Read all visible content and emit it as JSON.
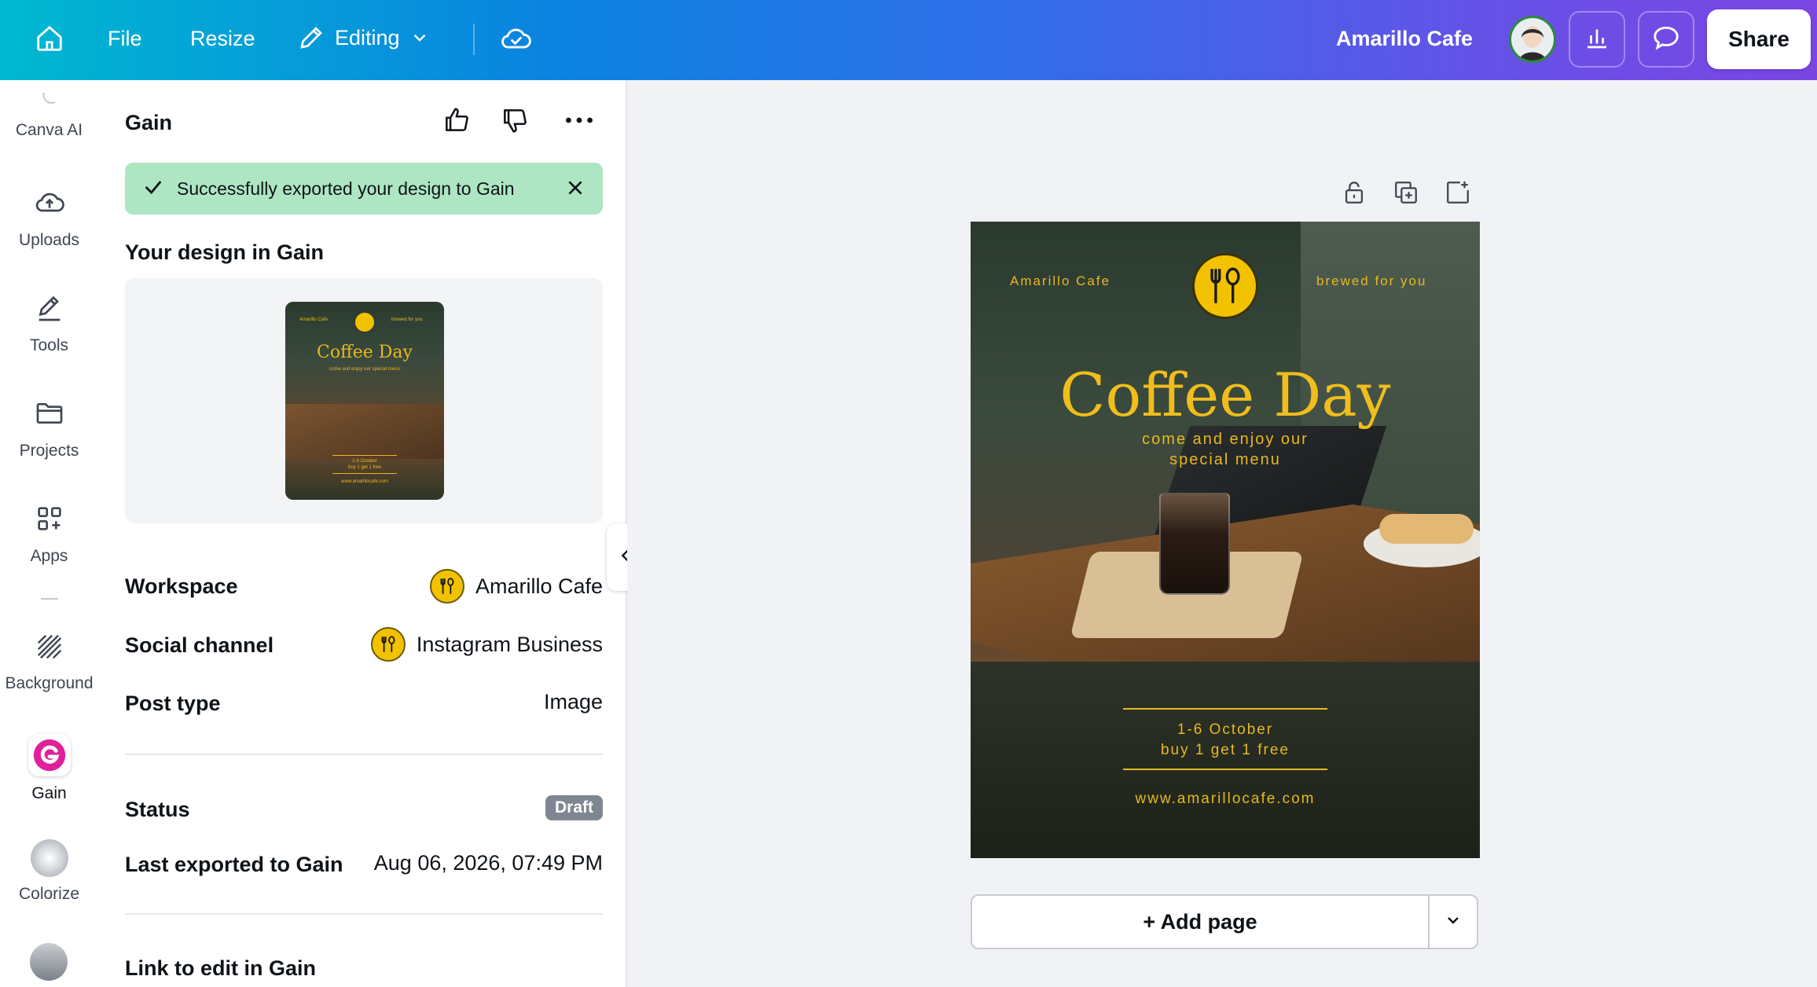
{
  "topbar": {
    "file_label": "File",
    "resize_label": "Resize",
    "editing_label": "Editing",
    "design_name": "Amarillo Cafe",
    "share_label": "Share"
  },
  "rail": {
    "items": [
      {
        "label": "Canva AI",
        "icon": "canva-ai-icon"
      },
      {
        "label": "Uploads",
        "icon": "upload-cloud-icon"
      },
      {
        "label": "Tools",
        "icon": "tools-icon"
      },
      {
        "label": "Projects",
        "icon": "folder-icon"
      },
      {
        "label": "Apps",
        "icon": "apps-icon"
      },
      {
        "label": "Background",
        "icon": "background-icon"
      },
      {
        "label": "Gain",
        "icon": "gain-icon"
      },
      {
        "label": "Colorize",
        "icon": "colorize-icon"
      }
    ]
  },
  "panel": {
    "title": "Gain",
    "toast": "Successfully exported your design to Gain",
    "design_heading": "Your design in Gain",
    "workspace_label": "Workspace",
    "workspace_value": "Amarillo Cafe",
    "social_label": "Social channel",
    "social_value": "Instagram Business",
    "post_type_label": "Post type",
    "post_type_value": "Image",
    "status_label": "Status",
    "status_value": "Draft",
    "exported_label": "Last exported to Gain",
    "exported_value": "Aug 06, 2026, 07:49 PM",
    "link_label": "Link to edit in Gain"
  },
  "poster": {
    "brand": "Amarillo Cafe",
    "tagline": "brewed for you",
    "title": "Coffee Day",
    "subtitle_line1": "come and enjoy our",
    "subtitle_line2": "special menu",
    "date": "1-6 October",
    "offer": "buy 1 get 1 free",
    "url": "www.amarillocafe.com"
  },
  "thumbnail": {
    "brand": "Amarillo Cafe",
    "tagline": "brewed for you",
    "title": "Coffee Day",
    "subtitle": "come and enjoy our special menu",
    "date": "1-6 October",
    "offer": "buy 1 get 1 free",
    "url": "www.amarillocafe.com"
  },
  "canvas": {
    "add_page_label": "+ Add page"
  },
  "colors": {
    "accent_yellow": "#e8b820",
    "toast_bg": "#aee6c4",
    "gain_pink": "#e0209a"
  }
}
